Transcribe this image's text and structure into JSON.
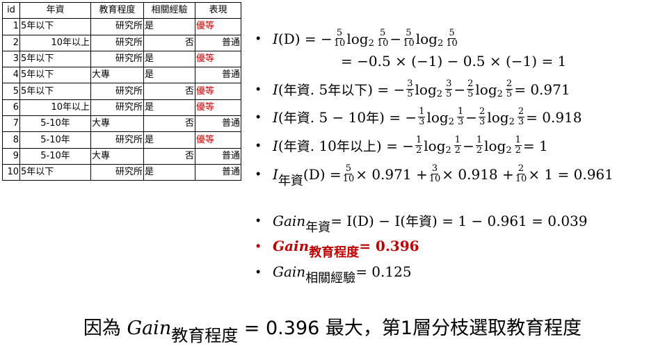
{
  "table": {
    "headers": [
      "id",
      "年資",
      "教育程度",
      "相關經驗",
      "表現"
    ],
    "rows": [
      [
        "1",
        "5年以下",
        "研究所",
        "是",
        "優等"
      ],
      [
        "2",
        "10年以上",
        "研究所",
        "否",
        "普通"
      ],
      [
        "3",
        "5年以下",
        "研究所",
        "是",
        "優等"
      ],
      [
        "4",
        "5年以下",
        "大專",
        "是",
        "普通"
      ],
      [
        "5",
        "5年以下",
        "研究所",
        "否",
        "優等"
      ],
      [
        "6",
        "10年以上",
        "研究所",
        "是",
        "優等"
      ],
      [
        "7",
        "5-10年",
        "大專",
        "否",
        "普通"
      ],
      [
        "8",
        "5-10年",
        "研究所",
        "是",
        "優等"
      ],
      [
        "9",
        "5-10年",
        "大專",
        "否",
        "普通"
      ],
      [
        "10",
        "5年以下",
        "研究所",
        "是",
        "普通"
      ]
    ],
    "highlight_color": "#d00000"
  },
  "bullet": "•",
  "formulas": [
    {
      "bullet": true,
      "parts": [
        {
          "i": "I"
        },
        {
          "t": "(D) = −"
        },
        {
          "f": [
            "5",
            "10"
          ]
        },
        {
          "t": "log"
        },
        {
          "s": "2"
        },
        {
          "f": [
            "5",
            "10"
          ]
        },
        {
          "t": " − "
        },
        {
          "f": [
            "5",
            "10"
          ]
        },
        {
          "t": "log"
        },
        {
          "s": "2"
        },
        {
          "f": [
            "5",
            "10"
          ]
        }
      ]
    },
    {
      "bullet": false,
      "parts": [
        {
          "t": "= −0.5 × (−1) − 0.5 × (−1) = 1"
        }
      ]
    },
    {
      "bullet": true,
      "parts": [
        {
          "i": "I"
        },
        {
          "t": "("
        },
        {
          "c": "年資"
        },
        {
          "t": ". 5"
        },
        {
          "c": "年以下"
        },
        {
          "t": ") = −"
        },
        {
          "f": [
            "3",
            "5"
          ]
        },
        {
          "t": "log"
        },
        {
          "s": "2"
        },
        {
          "f": [
            "3",
            "5"
          ]
        },
        {
          "t": " − "
        },
        {
          "f": [
            "2",
            "5"
          ]
        },
        {
          "t": "log"
        },
        {
          "s": "2"
        },
        {
          "f": [
            "2",
            "5"
          ]
        },
        {
          "t": " = 0.971"
        }
      ]
    },
    {
      "bullet": true,
      "parts": [
        {
          "i": "I"
        },
        {
          "t": "("
        },
        {
          "c": "年資"
        },
        {
          "t": ". 5 − 10"
        },
        {
          "c": "年"
        },
        {
          "t": ") = −"
        },
        {
          "f": [
            "1",
            "3"
          ]
        },
        {
          "t": "log"
        },
        {
          "s": "2"
        },
        {
          "f": [
            "1",
            "3"
          ]
        },
        {
          "t": " − "
        },
        {
          "f": [
            "2",
            "3"
          ]
        },
        {
          "t": "log"
        },
        {
          "s": "2"
        },
        {
          "f": [
            "2",
            "3"
          ]
        },
        {
          "t": " = 0.918"
        }
      ]
    },
    {
      "bullet": true,
      "parts": [
        {
          "i": "I"
        },
        {
          "t": "("
        },
        {
          "c": "年資"
        },
        {
          "t": ". 10"
        },
        {
          "c": "年以上"
        },
        {
          "t": ") = −"
        },
        {
          "f": [
            "1",
            "2"
          ]
        },
        {
          "t": "log"
        },
        {
          "s": "2"
        },
        {
          "f": [
            "1",
            "2"
          ]
        },
        {
          "t": " − "
        },
        {
          "f": [
            "1",
            "2"
          ]
        },
        {
          "t": "log"
        },
        {
          "s": "2"
        },
        {
          "f": [
            "1",
            "2"
          ]
        },
        {
          "t": " = 1"
        }
      ]
    },
    {
      "bullet": true,
      "parts": [
        {
          "i": "I"
        },
        {
          "sc": "年資"
        },
        {
          "t": "(D) = "
        },
        {
          "f": [
            "5",
            "10"
          ]
        },
        {
          "t": "× 0.971 + "
        },
        {
          "f": [
            "3",
            "10"
          ]
        },
        {
          "t": "× 0.918 + "
        },
        {
          "f": [
            "2",
            "10"
          ]
        },
        {
          "t": "× 1 = 0.961"
        }
      ]
    },
    {
      "bullet": true,
      "parts": [
        {
          "i": "Gain"
        },
        {
          "sc": "年資"
        },
        {
          "t": " = I(D) − I("
        },
        {
          "c": "年資"
        },
        {
          "t": ") = 1 − 0.961 = 0.039"
        }
      ]
    },
    {
      "bullet": true,
      "red": true,
      "parts": [
        {
          "i": "Gain"
        },
        {
          "sc": "教育程度"
        },
        {
          "t": " = 0.396"
        }
      ]
    },
    {
      "bullet": true,
      "parts": [
        {
          "i": "Gain"
        },
        {
          "sc": "相關經驗"
        },
        {
          "t": " = 0.125"
        }
      ]
    }
  ],
  "conclusion": {
    "prefix": "因為 ",
    "gain": "Gain",
    "sub": "教育程度",
    "suffix": " = 0.396 最大，第1層分枝選取教育程度"
  }
}
